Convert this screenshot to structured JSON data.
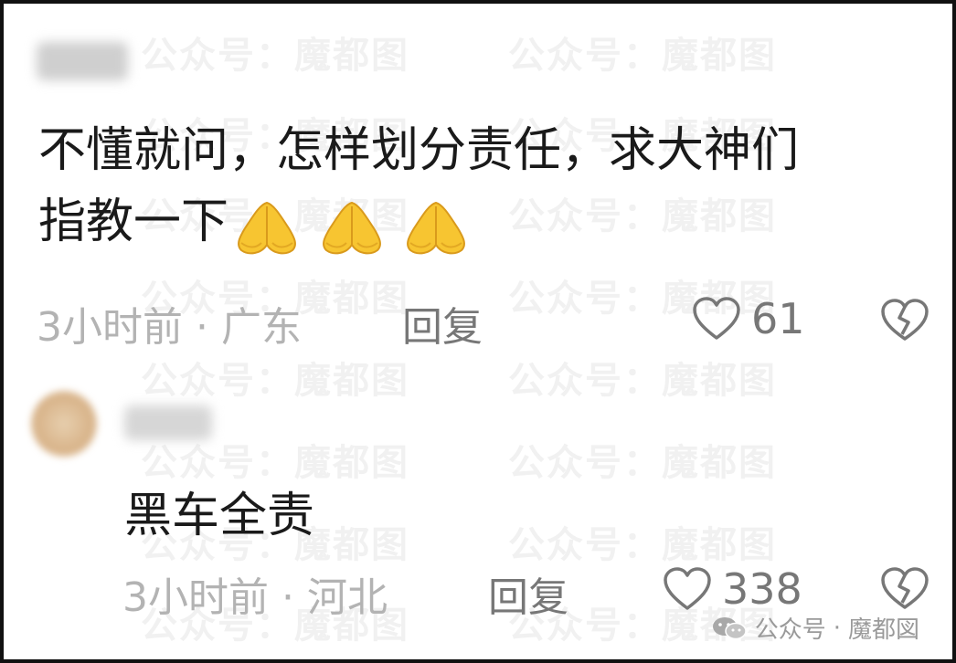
{
  "watermark": "公众号：魔都图",
  "comment1": {
    "text_line1": "不懂就问，怎样划分责任，求大神们",
    "text_line2": "指教一下",
    "emoji": "folded-hands-emoji",
    "time": "3小时前",
    "location": "广东",
    "reply_label": "回复",
    "like_count": "61"
  },
  "comment2": {
    "text": "黑车全责",
    "time": "3小时前",
    "location": "河北",
    "reply_label": "回复",
    "like_count": "338"
  },
  "source_tag": {
    "channel": "公众号",
    "name": "魔都図"
  },
  "colors": {
    "text_primary": "#1a1a1a",
    "text_meta": "#b3b3b3",
    "text_action": "#777777",
    "emoji_yellow": "#f7c531"
  }
}
